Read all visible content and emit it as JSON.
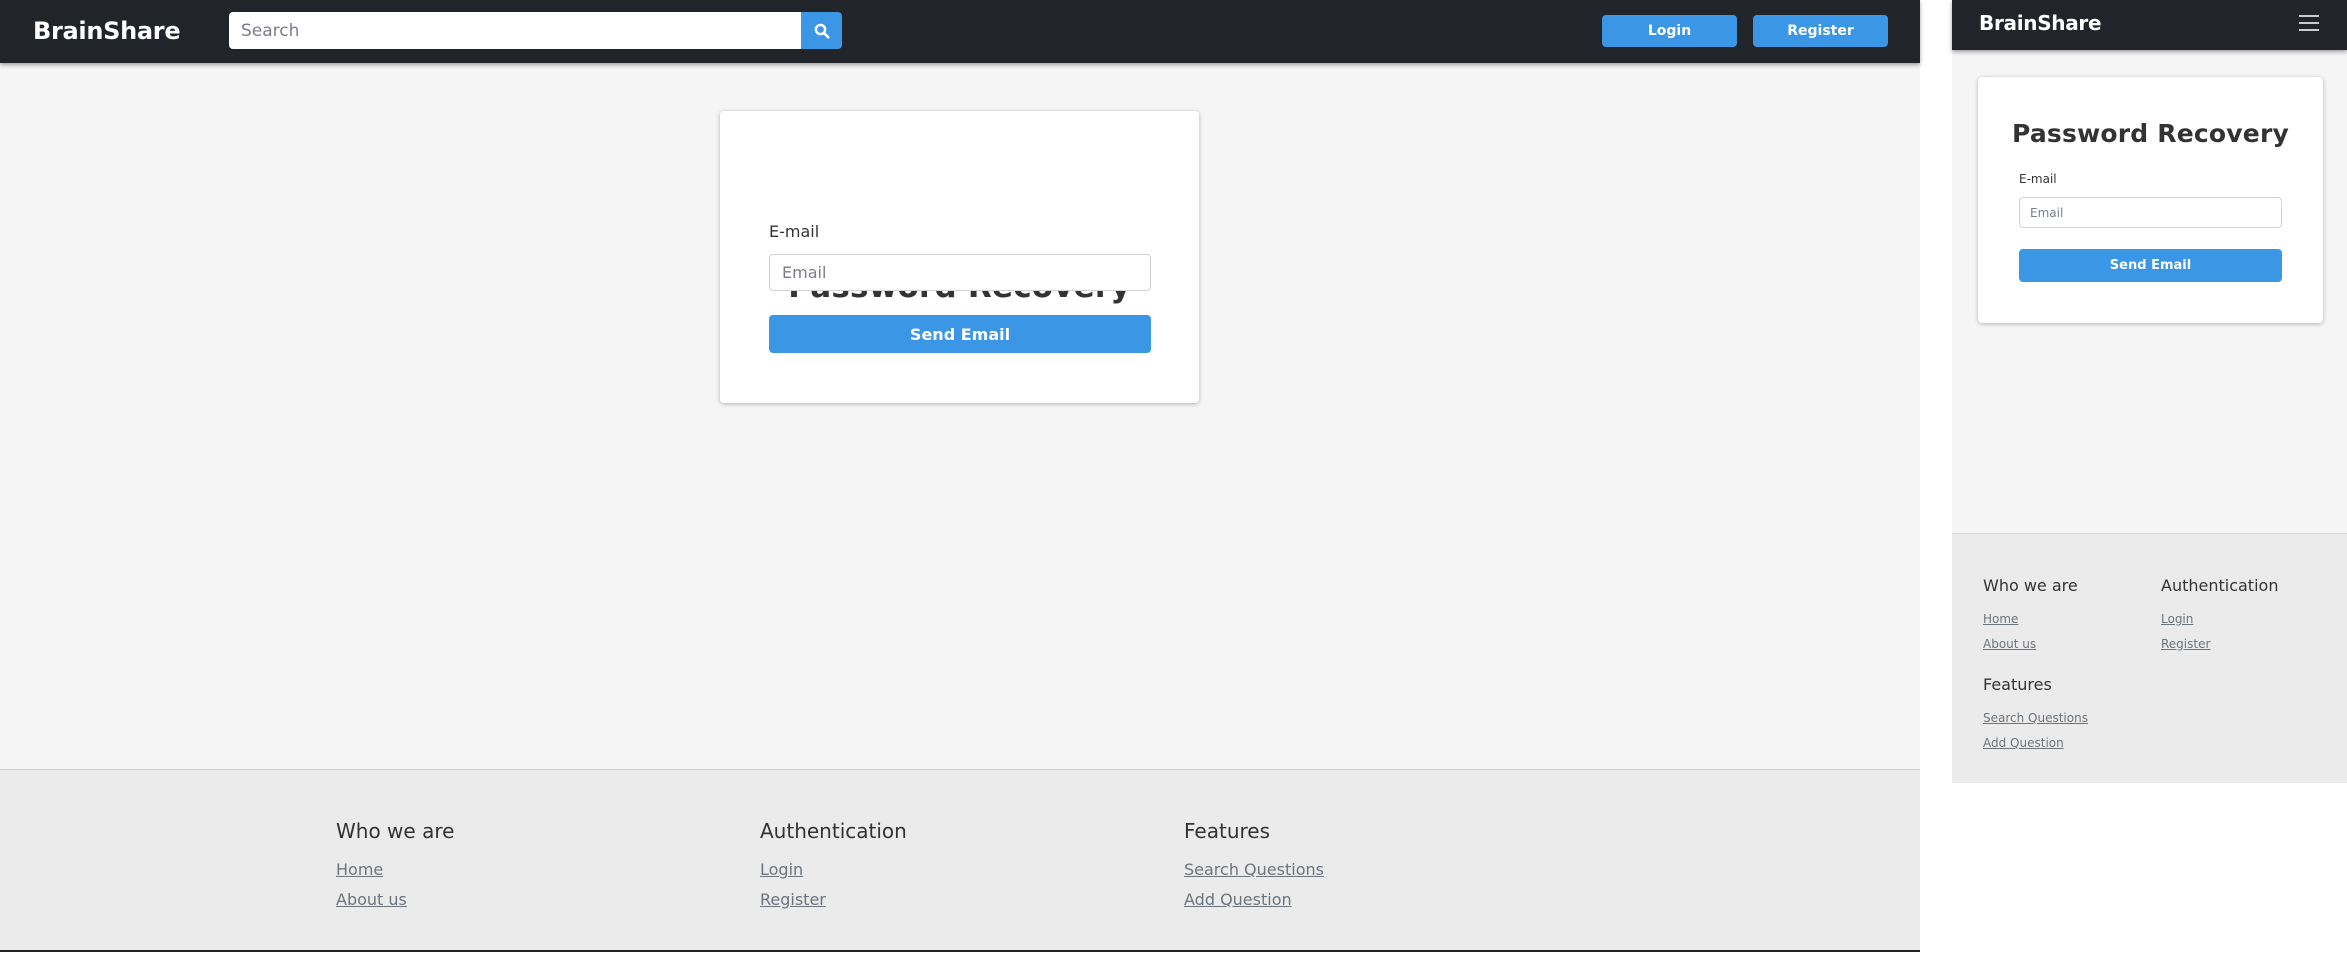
{
  "brand": "BrainShare",
  "colors": {
    "header_bg": "#212429",
    "accent": "#3c96e6",
    "page_bg": "#f5f5f5",
    "footer_bg": "#ebebeb",
    "link": "#6c757d"
  },
  "desktop": {
    "header": {
      "search_placeholder": "Search",
      "search_icon": "search-icon",
      "login_label": "Login",
      "register_label": "Register"
    },
    "recovery": {
      "title": "Password Recovery",
      "email_label": "E-mail",
      "email_placeholder": "Email",
      "email_value": "",
      "submit_label": "Send Email"
    }
  },
  "mobile": {
    "header": {
      "menu_icon": "hamburger-menu-icon"
    },
    "recovery": {
      "title": "Password Recovery",
      "email_label": "E-mail",
      "email_placeholder": "Email",
      "email_value": "",
      "submit_label": "Send Email"
    }
  },
  "footer": {
    "columns": [
      {
        "heading": "Who we are",
        "links": [
          "Home",
          "About us"
        ]
      },
      {
        "heading": "Authentication",
        "links": [
          "Login",
          "Register"
        ]
      },
      {
        "heading": "Features",
        "links": [
          "Search Questions",
          "Add Question"
        ]
      }
    ]
  }
}
